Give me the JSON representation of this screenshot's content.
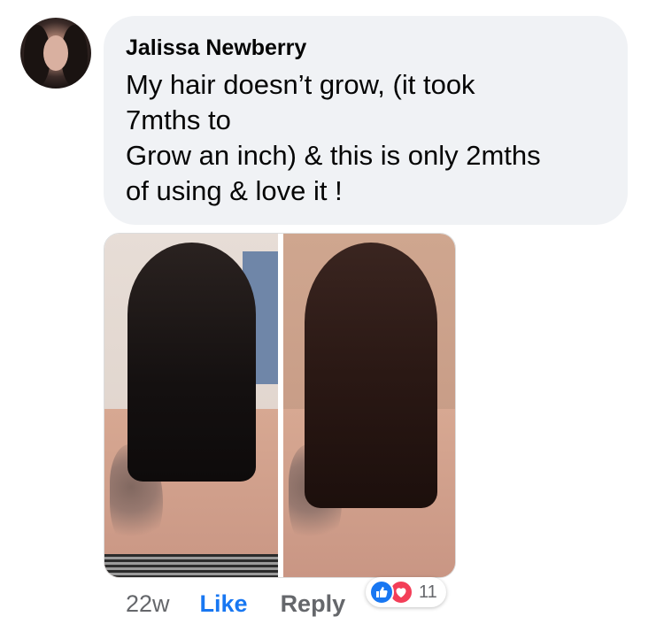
{
  "comment": {
    "author": "Jalissa Newberry",
    "text_lines": [
      "My hair doesn’t grow, (it took",
      "7mths to",
      "Grow an inch) & this is only 2mths",
      "of using & love it !"
    ],
    "avatar_icon": "profile-photo",
    "photo_description_icon": "before-after-hair-photo"
  },
  "actions": {
    "time": "22w",
    "like_label": "Like",
    "reply_label": "Reply"
  },
  "reactions": {
    "icons": [
      "like-reaction-icon",
      "love-reaction-icon"
    ],
    "count": "11"
  },
  "colors": {
    "bubble": "#f0f2f5",
    "like_blue": "#1877f2",
    "meta_gray": "#65676b",
    "love_red": "#f33e58"
  }
}
